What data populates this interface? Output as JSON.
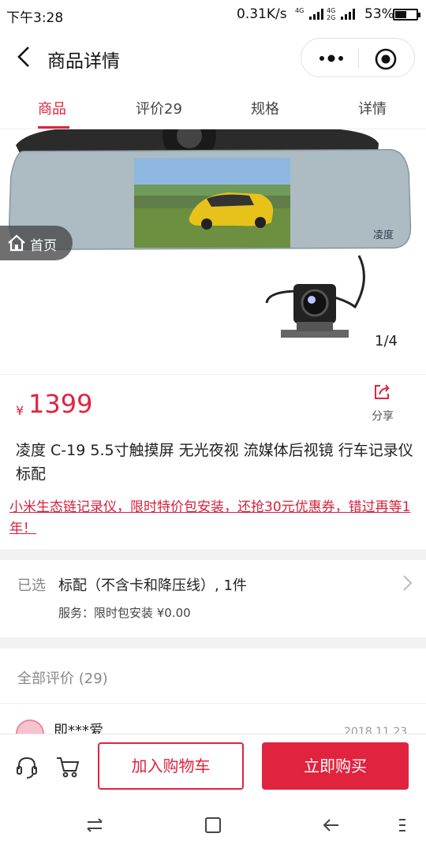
{
  "status_bar": {
    "time": "下午3:28",
    "speed": "0.31K/s",
    "net_top": "4G",
    "net_second": "4G",
    "net_sub": "2G",
    "battery": "53%",
    "battery_level": 0.53
  },
  "header": {
    "title": "商品详情"
  },
  "tabs": [
    {
      "label": "商品",
      "active": true
    },
    {
      "label": "评价29",
      "active": false
    },
    {
      "label": "规格",
      "active": false
    },
    {
      "label": "详情",
      "active": false
    }
  ],
  "gallery": {
    "counter": "1/4",
    "home_label": "首页",
    "brand_mark": "凌度"
  },
  "price": {
    "currency": "¥",
    "value": "1399",
    "share_label": "分享"
  },
  "product": {
    "name": "凌度 C-19 5.5寸触摸屏 无光夜视 流媒体后视镜 行车记录仪 标配",
    "promo": "小米生态链记录仪，限时特价包安装，还抢30元优惠券，错过再等1年！"
  },
  "selection": {
    "label": "已选",
    "value": "标配（不含卡和降压线）, 1件",
    "service": "服务：限时包安装 ¥0.00"
  },
  "reviews": {
    "heading": "全部评价",
    "count": "(29)",
    "first_user": "即***爱",
    "first_date": "2018.11.23"
  },
  "actions": {
    "add_to_cart": "加入购物车",
    "buy_now": "立即购买"
  },
  "colors": {
    "accent": "#e0233f"
  }
}
